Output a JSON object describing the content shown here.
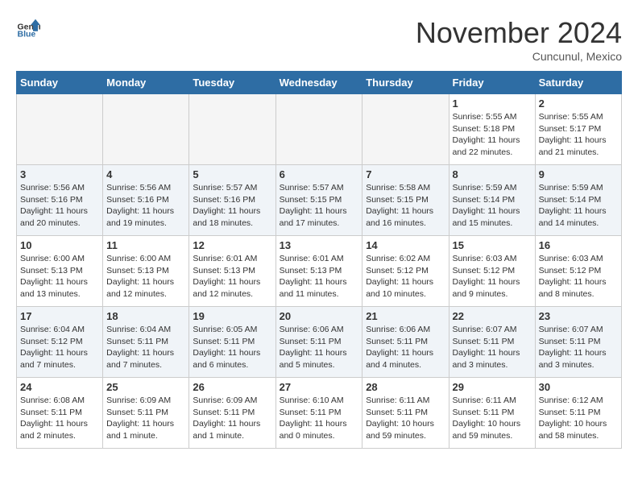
{
  "header": {
    "logo_general": "General",
    "logo_blue": "Blue",
    "month": "November 2024",
    "location": "Cuncunul, Mexico"
  },
  "calendar": {
    "days_of_week": [
      "Sunday",
      "Monday",
      "Tuesday",
      "Wednesday",
      "Thursday",
      "Friday",
      "Saturday"
    ],
    "weeks": [
      [
        {
          "day": "",
          "detail": ""
        },
        {
          "day": "",
          "detail": ""
        },
        {
          "day": "",
          "detail": ""
        },
        {
          "day": "",
          "detail": ""
        },
        {
          "day": "",
          "detail": ""
        },
        {
          "day": "1",
          "detail": "Sunrise: 5:55 AM\nSunset: 5:18 PM\nDaylight: 11 hours\nand 22 minutes."
        },
        {
          "day": "2",
          "detail": "Sunrise: 5:55 AM\nSunset: 5:17 PM\nDaylight: 11 hours\nand 21 minutes."
        }
      ],
      [
        {
          "day": "3",
          "detail": "Sunrise: 5:56 AM\nSunset: 5:16 PM\nDaylight: 11 hours\nand 20 minutes."
        },
        {
          "day": "4",
          "detail": "Sunrise: 5:56 AM\nSunset: 5:16 PM\nDaylight: 11 hours\nand 19 minutes."
        },
        {
          "day": "5",
          "detail": "Sunrise: 5:57 AM\nSunset: 5:16 PM\nDaylight: 11 hours\nand 18 minutes."
        },
        {
          "day": "6",
          "detail": "Sunrise: 5:57 AM\nSunset: 5:15 PM\nDaylight: 11 hours\nand 17 minutes."
        },
        {
          "day": "7",
          "detail": "Sunrise: 5:58 AM\nSunset: 5:15 PM\nDaylight: 11 hours\nand 16 minutes."
        },
        {
          "day": "8",
          "detail": "Sunrise: 5:59 AM\nSunset: 5:14 PM\nDaylight: 11 hours\nand 15 minutes."
        },
        {
          "day": "9",
          "detail": "Sunrise: 5:59 AM\nSunset: 5:14 PM\nDaylight: 11 hours\nand 14 minutes."
        }
      ],
      [
        {
          "day": "10",
          "detail": "Sunrise: 6:00 AM\nSunset: 5:13 PM\nDaylight: 11 hours\nand 13 minutes."
        },
        {
          "day": "11",
          "detail": "Sunrise: 6:00 AM\nSunset: 5:13 PM\nDaylight: 11 hours\nand 12 minutes."
        },
        {
          "day": "12",
          "detail": "Sunrise: 6:01 AM\nSunset: 5:13 PM\nDaylight: 11 hours\nand 12 minutes."
        },
        {
          "day": "13",
          "detail": "Sunrise: 6:01 AM\nSunset: 5:13 PM\nDaylight: 11 hours\nand 11 minutes."
        },
        {
          "day": "14",
          "detail": "Sunrise: 6:02 AM\nSunset: 5:12 PM\nDaylight: 11 hours\nand 10 minutes."
        },
        {
          "day": "15",
          "detail": "Sunrise: 6:03 AM\nSunset: 5:12 PM\nDaylight: 11 hours\nand 9 minutes."
        },
        {
          "day": "16",
          "detail": "Sunrise: 6:03 AM\nSunset: 5:12 PM\nDaylight: 11 hours\nand 8 minutes."
        }
      ],
      [
        {
          "day": "17",
          "detail": "Sunrise: 6:04 AM\nSunset: 5:12 PM\nDaylight: 11 hours\nand 7 minutes."
        },
        {
          "day": "18",
          "detail": "Sunrise: 6:04 AM\nSunset: 5:11 PM\nDaylight: 11 hours\nand 7 minutes."
        },
        {
          "day": "19",
          "detail": "Sunrise: 6:05 AM\nSunset: 5:11 PM\nDaylight: 11 hours\nand 6 minutes."
        },
        {
          "day": "20",
          "detail": "Sunrise: 6:06 AM\nSunset: 5:11 PM\nDaylight: 11 hours\nand 5 minutes."
        },
        {
          "day": "21",
          "detail": "Sunrise: 6:06 AM\nSunset: 5:11 PM\nDaylight: 11 hours\nand 4 minutes."
        },
        {
          "day": "22",
          "detail": "Sunrise: 6:07 AM\nSunset: 5:11 PM\nDaylight: 11 hours\nand 3 minutes."
        },
        {
          "day": "23",
          "detail": "Sunrise: 6:07 AM\nSunset: 5:11 PM\nDaylight: 11 hours\nand 3 minutes."
        }
      ],
      [
        {
          "day": "24",
          "detail": "Sunrise: 6:08 AM\nSunset: 5:11 PM\nDaylight: 11 hours\nand 2 minutes."
        },
        {
          "day": "25",
          "detail": "Sunrise: 6:09 AM\nSunset: 5:11 PM\nDaylight: 11 hours\nand 1 minute."
        },
        {
          "day": "26",
          "detail": "Sunrise: 6:09 AM\nSunset: 5:11 PM\nDaylight: 11 hours\nand 1 minute."
        },
        {
          "day": "27",
          "detail": "Sunrise: 6:10 AM\nSunset: 5:11 PM\nDaylight: 11 hours\nand 0 minutes."
        },
        {
          "day": "28",
          "detail": "Sunrise: 6:11 AM\nSunset: 5:11 PM\nDaylight: 10 hours\nand 59 minutes."
        },
        {
          "day": "29",
          "detail": "Sunrise: 6:11 AM\nSunset: 5:11 PM\nDaylight: 10 hours\nand 59 minutes."
        },
        {
          "day": "30",
          "detail": "Sunrise: 6:12 AM\nSunset: 5:11 PM\nDaylight: 10 hours\nand 58 minutes."
        }
      ]
    ]
  }
}
